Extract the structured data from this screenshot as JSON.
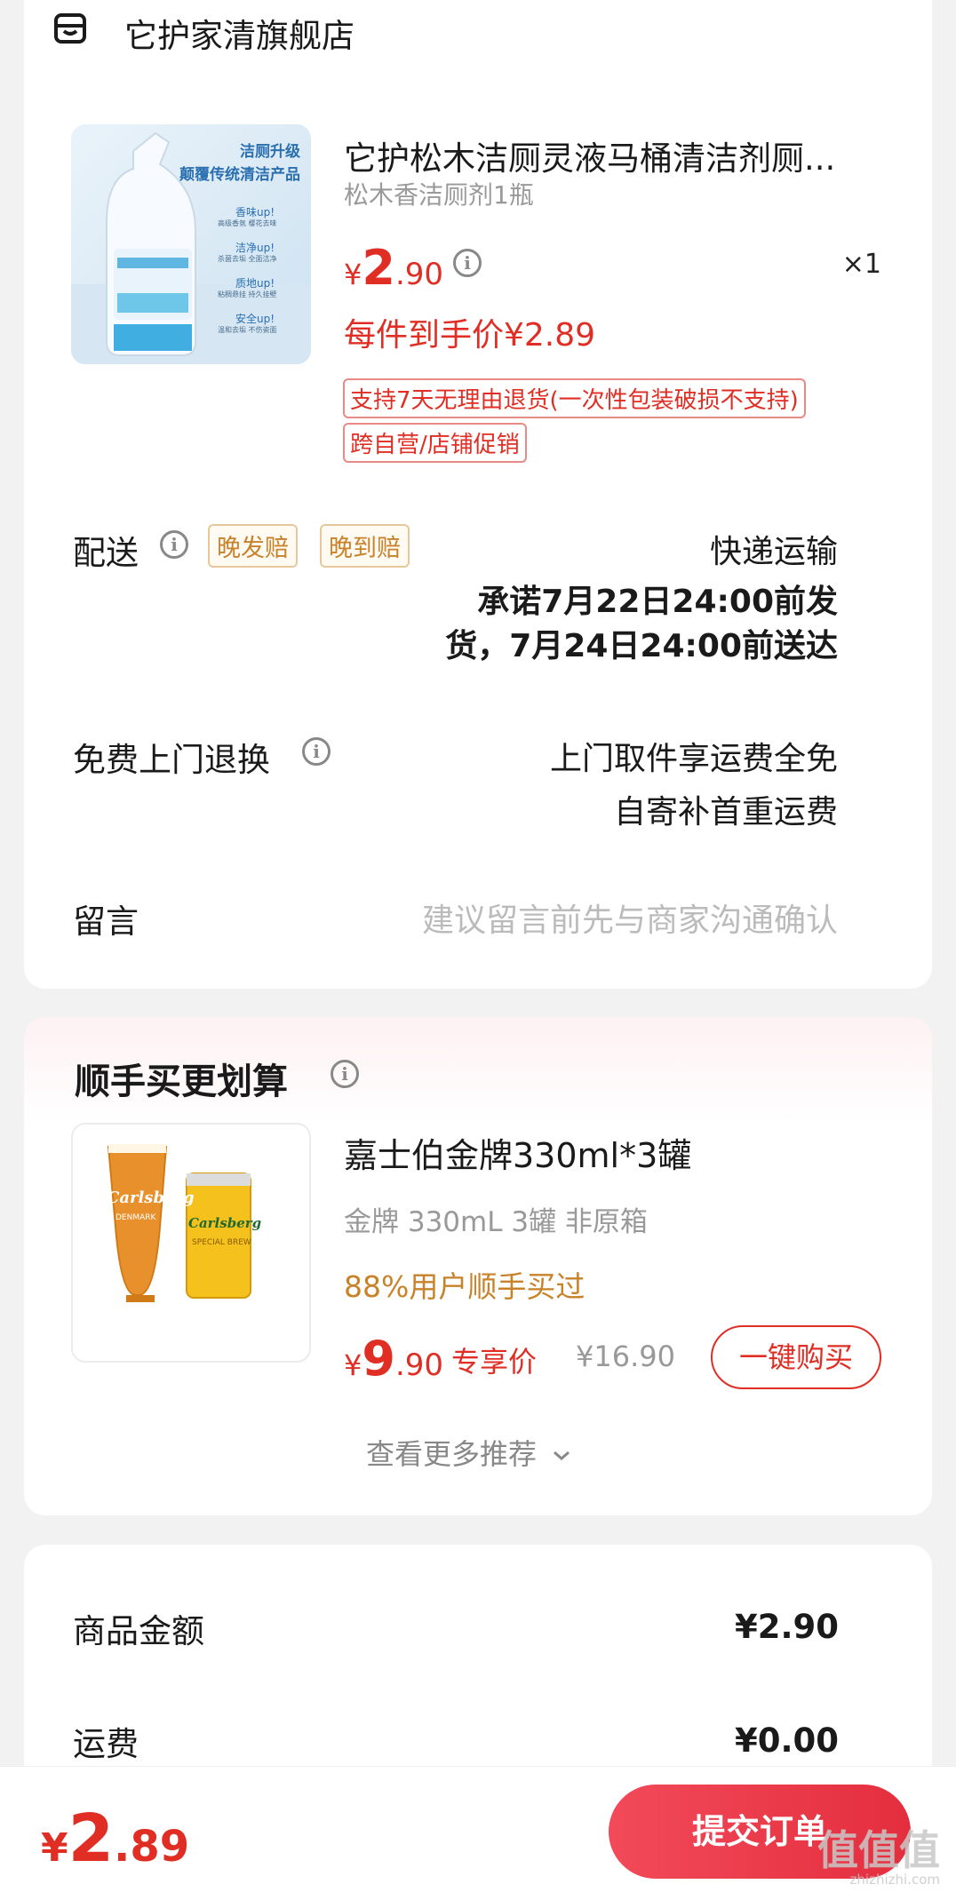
{
  "store": {
    "name": "它护家清旗舰店",
    "icon": "store-icon"
  },
  "product": {
    "title": "它护松木洁厕灵液马桶清洁剂厕...",
    "spec": "松木香洁厕剂1瓶",
    "price_yen": "¥",
    "price_int": "2",
    "price_dec": ".90",
    "quantity": "×1",
    "final_price": "每件到手价¥2.89",
    "tags": [
      "支持7天无理由退货(一次性包装破损不支持)",
      "跨自营/店铺促销"
    ],
    "image_text": {
      "headline1": "洁厕升级",
      "headline2": "颠覆传统清洁产品",
      "badges": [
        "香味up!",
        "洁净up!",
        "质地up!",
        "安全up!"
      ],
      "badge_captions": [
        "高级香氛 樱花去味",
        "杀菌去垢 全面洁净",
        "粘稠悬挂 持久挂壁",
        "温和去垢 不伤瓷面"
      ]
    }
  },
  "delivery": {
    "label": "配送",
    "badges": [
      "晚发赔",
      "晚到赔"
    ],
    "method": "快递运输",
    "promise_line1": "承诺7月22日24:00前发",
    "promise_line2": "货，7月24日24:00前送达"
  },
  "returns": {
    "label": "免费上门退换",
    "line1": "上门取件享运费全免",
    "line2": "自寄补首重运费"
  },
  "message": {
    "label": "留言",
    "placeholder": "建议留言前先与商家沟通确认"
  },
  "upsell": {
    "section_title": "顺手买更划算",
    "title": "嘉士伯金牌330ml*3罐",
    "spec": "金牌 330mL 3罐 非原箱",
    "social": "88%用户顺手买过",
    "price_yen": "¥",
    "price_int": "9",
    "price_dec": ".90",
    "exclusive_label": "专享价",
    "original_price": "¥16.90",
    "buy_button": "一键购买",
    "more_link": "查看更多推荐",
    "image_text": {
      "brand": "Carlsberg",
      "glass_text": "DENMARK",
      "can_text": "SPECIAL BREW"
    }
  },
  "summary": {
    "items_label": "商品金额",
    "items_value": "¥2.90",
    "shipping_label": "运费",
    "shipping_value": "¥0.00"
  },
  "footer": {
    "total_yen": "¥",
    "total_int": "2",
    "total_dec": ".89",
    "submit_button": "提交订单",
    "watermark": "值值值",
    "watermark_url": "zhizhizhi.com"
  },
  "colors": {
    "accent_red": "#e02e24",
    "orange": "#c8832a",
    "background": "#f2f2f2"
  }
}
